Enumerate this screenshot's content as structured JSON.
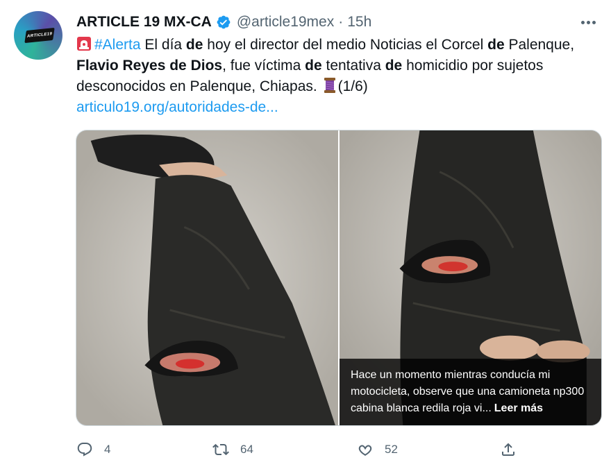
{
  "account": {
    "display_name": "ARTICLE 19 MX-CA",
    "handle": "@article19mex",
    "separator": "·",
    "time": "15h",
    "avatar_text": "ARTICLE19"
  },
  "tweet": {
    "hashtag": "#Alerta",
    "t1": " El día ",
    "b1": "de",
    "t2": " hoy el director del medio Noticias el Corcel ",
    "b2": "de",
    "t3": " Palenque, ",
    "b3": "Flavio Reyes de Dios",
    "t4": ", fue víctima ",
    "b4": "de",
    "t5": " tentativa ",
    "b5": "de",
    "t6": " homicidio por sujetos desconocidos en Palenque, Chiapas. ",
    "counter": "(1/6)",
    "link": "articulo19.org/autoridades-de..."
  },
  "media": {
    "caption": "Hace un momento mientras conducía mi motocicleta, observe que una camioneta np300 cabina blanca redila roja vi...",
    "read_more": "Leer más"
  },
  "actions": {
    "replies": "4",
    "retweets": "64",
    "likes": "52"
  },
  "colors": {
    "link": "#1d9bf0",
    "muted": "#536471",
    "text": "#0f1419",
    "verified": "#1d9bf0"
  },
  "icons": [
    "more-icon",
    "verified-icon",
    "siren-emoji",
    "thread-emoji",
    "reply-icon",
    "retweet-icon",
    "like-icon",
    "share-icon"
  ]
}
